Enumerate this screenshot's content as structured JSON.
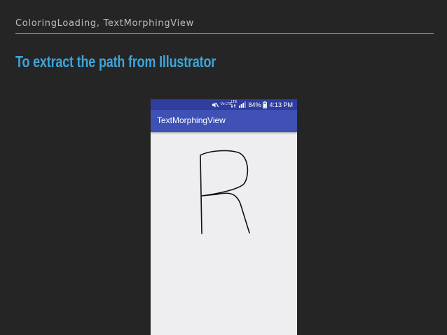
{
  "header": {
    "text": "ColoringLoading, TextMorphingView"
  },
  "slide": {
    "title": "To extract the path from Illustrator"
  },
  "phone": {
    "status_bar": {
      "icons": [
        "mute-icon",
        "volte-icon",
        "lte-icon",
        "signal-icon",
        "battery-icon"
      ],
      "volte_text": "Vo LTE",
      "lte_text": "LTE",
      "battery": "84%",
      "time": "4:13 PM"
    },
    "app_bar": {
      "title": "TextMorphingView"
    },
    "canvas": {
      "morphing_letter": "R"
    }
  },
  "colors": {
    "background": "#252525",
    "title_accent": "#3ea4d8",
    "status_bar": "#303f9f",
    "app_bar": "#3f51b5",
    "phone_background": "#eeeef0",
    "stroke": "#000000"
  }
}
